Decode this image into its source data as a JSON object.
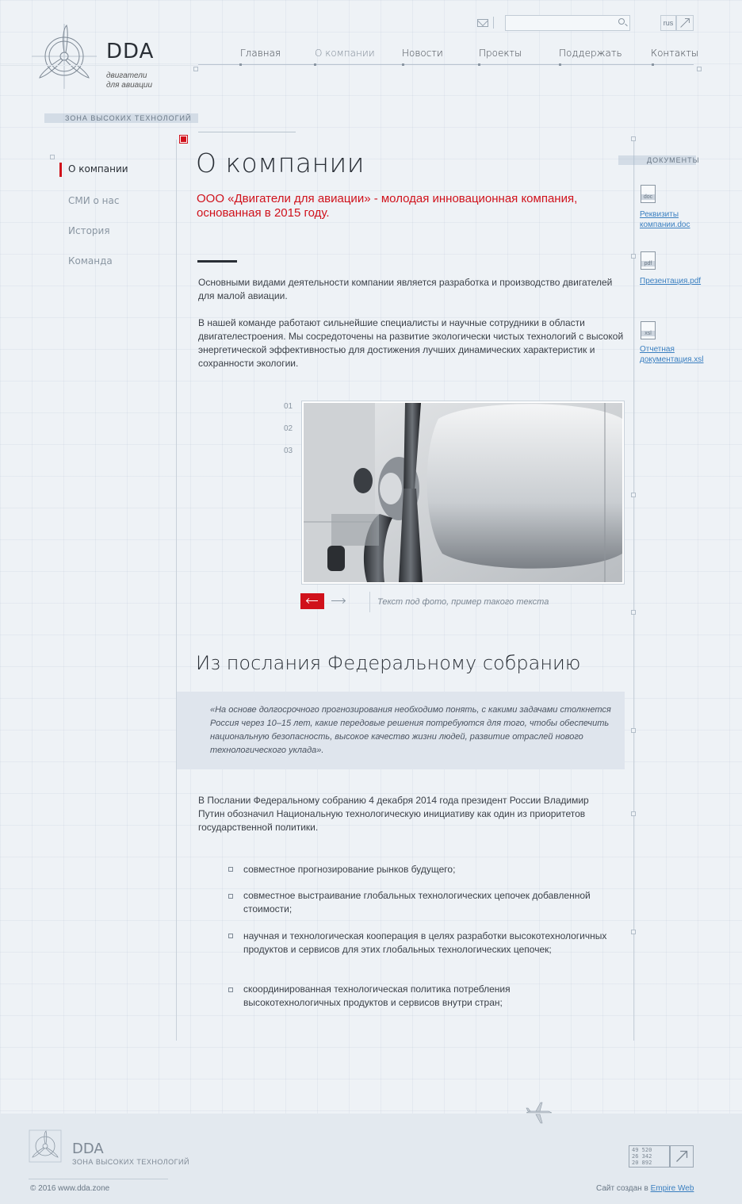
{
  "brand": {
    "title": "DDA",
    "subtitle_line1": "двигатели",
    "subtitle_line2": "для авиации",
    "zone": "ЗОНА ВЫСОКИХ ТЕХНОЛОГИЙ"
  },
  "header": {
    "lang": "rus",
    "nav": [
      "Главная",
      "О компании",
      "Новости",
      "Проекты",
      "Поддержать",
      "Контакты"
    ],
    "active_nav": "О компании"
  },
  "sidebar": {
    "items": [
      "О компании",
      "СМИ о нас",
      "История",
      "Команда"
    ],
    "active": "О компании"
  },
  "main": {
    "title": "О компании",
    "lead": "ООО «Двигатели для авиации» - молодая инновационная компания, основанная в 2015 году.",
    "para1": "Основными видами деятельности компании является разработка и производство двигателей для малой авиации.",
    "para2": "В нашей команде работают сильнейшие специалисты и научные сотрудники в области двигателестроения. Мы сосредоточены на развитие экологически чистых технологий с высокой энергетической эффективностью для достижения лучших динамических характеристик и сохранности экологии.",
    "slider": {
      "numbers": [
        "01",
        "02",
        "03"
      ],
      "caption": "Текст под фото, пример такого текста"
    },
    "section_title": "Из послания Федеральному собранию",
    "quote": "«На основе долгосрочного прогнозирования необходимо понять, с какими задачами столкнется Россия через 10–15 лет, какие передовые решения потребуются для того, чтобы обеспечить национальную безопасность, высокое качество жизни людей, развитие отраслей нового технологического уклада».",
    "para3": "В Послании Федеральному собранию 4 декабря 2014 года президент России Владимир Путин обозначил Национальную технологическую инициативу как один из приоритетов государственной политики.",
    "list": [
      "совместное прогнозирование рынков будущего;",
      "совместное выстраивание глобальных технологических цепочек добавленной стоимости;",
      "научная и технологическая кооперация в целях разработки высокотехнологичных продуктов и сервисов для этих глобальных технологических цепочек;",
      "скоординированная технологическая политика потребления высокотехнологичных продуктов и сервисов внутри стран;"
    ]
  },
  "documents": {
    "title": "ДОКУМЕНТЫ",
    "items": [
      {
        "ext": "doc",
        "name": "Реквизиты компании.doc"
      },
      {
        "ext": "pdf",
        "name": "Презентация.pdf"
      },
      {
        "ext": "xsl",
        "name": "Отчетная документация.xsl"
      }
    ]
  },
  "footer": {
    "title": "DDA",
    "subtitle": "ЗОНА ВЫСОКИХ ТЕХНОЛОГИЙ",
    "copyright": "© 2016   www.dda.zone",
    "made_by_prefix": "Сайт создан в",
    "made_by_link": "Empire Web",
    "counter_lines": [
      "49 520",
      "26 342",
      "20 892"
    ]
  },
  "colors": {
    "accent": "#d0111b",
    "link": "#3a7fc0",
    "background": "#eef2f6"
  }
}
